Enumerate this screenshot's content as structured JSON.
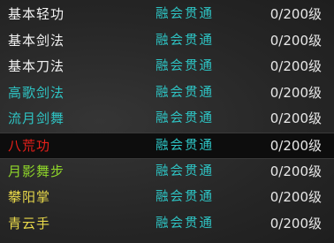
{
  "skills": [
    {
      "name": "基本轻功",
      "mastery": "融会贯通",
      "level": "0/200级",
      "name_color": "white"
    },
    {
      "name": "基本剑法",
      "mastery": "融会贯通",
      "level": "0/200级",
      "name_color": "white"
    },
    {
      "name": "基本刀法",
      "mastery": "融会贯通",
      "level": "0/200级",
      "name_color": "white"
    },
    {
      "name": "高歌剑法",
      "mastery": "融会贯通",
      "level": "0/200级",
      "name_color": "cyan"
    },
    {
      "name": "流月剑舞",
      "mastery": "融会贯通",
      "level": "0/200级",
      "name_color": "cyan"
    },
    {
      "name": "八荒功",
      "mastery": "融会贯通",
      "level": "0/200级",
      "name_color": "red",
      "selected": true
    },
    {
      "name": "月影舞步",
      "mastery": "融会贯通",
      "level": "0/200级",
      "name_color": "green"
    },
    {
      "name": "攀阳掌",
      "mastery": "融会贯通",
      "level": "0/200级",
      "name_color": "yellow"
    },
    {
      "name": "青云手",
      "mastery": "融会贯通",
      "level": "0/200级",
      "name_color": "yellow"
    }
  ],
  "colors": {
    "white": "#f2f2f2",
    "cyan": "#2ec4c4",
    "red": "#e8201a",
    "green": "#8fd62a",
    "yellow": "#e8d84a",
    "background": "#262626",
    "selected_background": "#0d0d0d"
  }
}
